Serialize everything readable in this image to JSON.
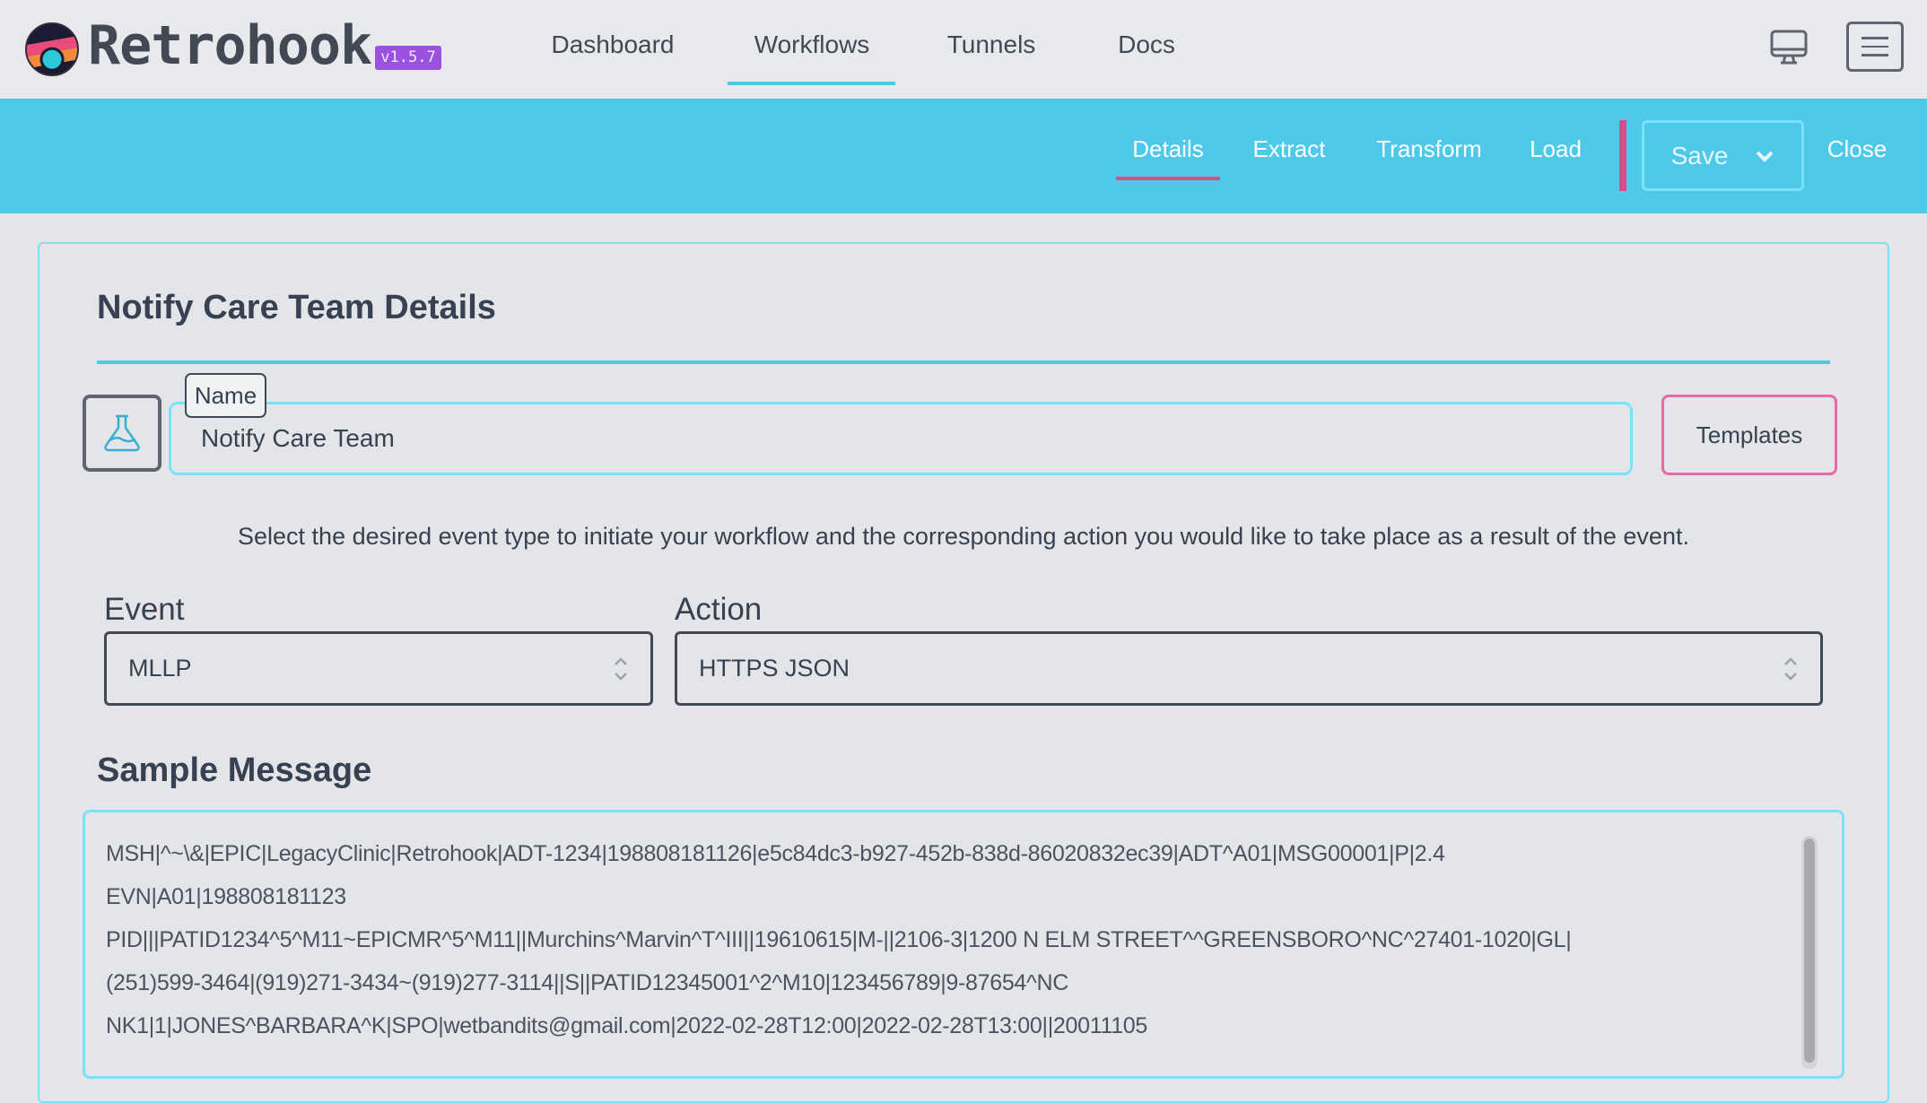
{
  "app": {
    "name": "Retrohook",
    "version": "v1.5.7"
  },
  "nav": {
    "items": [
      {
        "label": "Dashboard"
      },
      {
        "label": "Workflows",
        "active": true
      },
      {
        "label": "Tunnels"
      },
      {
        "label": "Docs"
      }
    ]
  },
  "icons": {
    "monitor": "monitor-icon",
    "menu": "hamburger-menu-icon",
    "flask": "flask-icon",
    "save_chevron": "chevron-down-icon",
    "select": "chevron-up-down-icon"
  },
  "subnav": {
    "items": [
      {
        "label": "Details",
        "active": true
      },
      {
        "label": "Extract"
      },
      {
        "label": "Transform"
      },
      {
        "label": "Load"
      }
    ],
    "save_label": "Save",
    "close_label": "Close"
  },
  "colors": {
    "accent": "#4ec9ea",
    "pink": "#db4b8a",
    "badge": "#9b51e0"
  },
  "details": {
    "title": "Notify Care Team Details",
    "name_label": "Name",
    "name_value": "Notify Care Team",
    "templates_label": "Templates",
    "description": "Select the desired event type to initiate your workflow and the corresponding action you would like to take place as a result of the event.",
    "event_label": "Event",
    "event_value": "MLLP",
    "action_label": "Action",
    "action_value": "HTTPS JSON"
  },
  "sample": {
    "title": "Sample Message",
    "lines": [
      "MSH|^~\\&|EPIC|LegacyClinic|Retrohook|ADT-1234|198808181126|e5c84dc3-b927-452b-838d-86020832ec39|ADT^A01|MSG00001|P|2.4",
      "EVN|A01|198808181123",
      "PID|||PATID1234^5^M11~EPICMR^5^M11||Murchins^Marvin^T^III||19610615|M-||2106-3|1200 N ELM STREET^^GREENSBORO^NC^27401-1020|GL|",
      "(251)599-3464|(919)271-3434~(919)277-3114||S||PATID12345001^2^M10|123456789|9-87654^NC",
      "NK1|1|JONES^BARBARA^K|SPO|wetbandits@gmail.com|2022-02-28T12:00|2022-02-28T13:00||20011105"
    ]
  }
}
